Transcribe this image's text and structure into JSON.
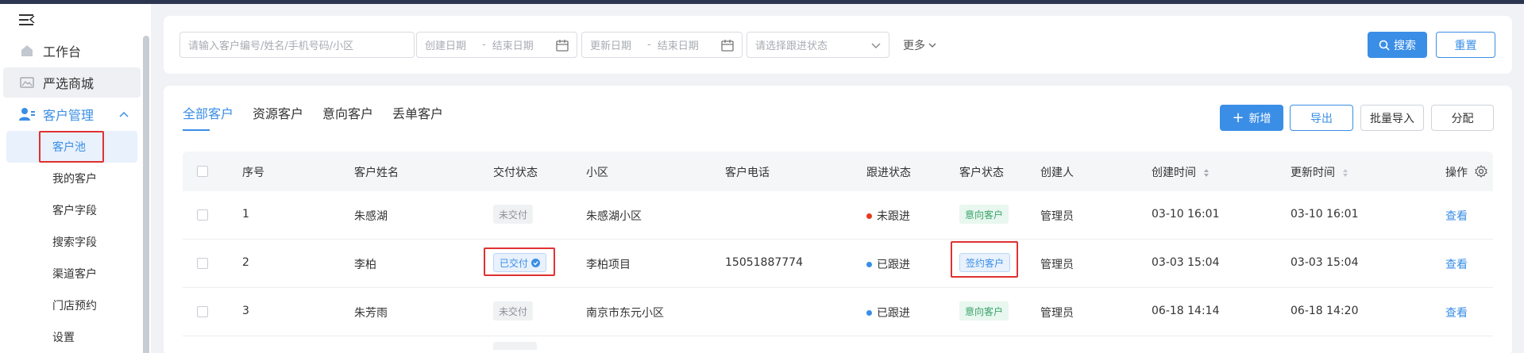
{
  "sidebar": {
    "items": [
      {
        "label": "工作台"
      },
      {
        "label": "严选商城"
      },
      {
        "label": "客户管理"
      }
    ],
    "sub_items": [
      {
        "label": "客户池"
      },
      {
        "label": "我的客户"
      },
      {
        "label": "客户字段"
      },
      {
        "label": "搜索字段"
      },
      {
        "label": "渠道客户"
      },
      {
        "label": "门店预约"
      },
      {
        "label": "设置"
      }
    ]
  },
  "filters": {
    "search_placeholder": "请输入客户编号/姓名/手机号码/小区",
    "created_start": "创建日期",
    "created_end": "结束日期",
    "updated_start": "更新日期",
    "updated_end": "结束日期",
    "follow_status_placeholder": "请选择跟进状态",
    "more_label": "更多",
    "search_button": "搜索",
    "reset_button": "重置",
    "separator": "-"
  },
  "tabs": [
    {
      "label": "全部客户"
    },
    {
      "label": "资源客户"
    },
    {
      "label": "意向客户"
    },
    {
      "label": "丢单客户"
    }
  ],
  "actions": {
    "add": "新增",
    "export": "导出",
    "batch_import": "批量导入",
    "assign": "分配"
  },
  "table": {
    "headers": {
      "index": "序号",
      "name": "客户姓名",
      "delivery": "交付状态",
      "community": "小区",
      "phone": "客户电话",
      "follow": "跟进状态",
      "customer_status": "客户状态",
      "creator": "创建人",
      "created": "创建时间",
      "updated": "更新时间",
      "ops": "操作"
    },
    "rows": [
      {
        "index": "1",
        "name": "朱感湖",
        "delivery": "未交付",
        "community": "朱感湖小区",
        "phone": "",
        "follow": "未跟进",
        "customer_status": "意向客户",
        "creator": "管理员",
        "created": "03-10 16:01",
        "updated": "03-10 16:01",
        "op": "查看"
      },
      {
        "index": "2",
        "name": "李柏",
        "delivery": "已交付",
        "community": "李柏项目",
        "phone": "15051887774",
        "follow": "已跟进",
        "customer_status": "签约客户",
        "creator": "管理员",
        "created": "03-03 15:04",
        "updated": "03-03 15:04",
        "op": "查看"
      },
      {
        "index": "3",
        "name": "朱芳雨",
        "delivery": "未交付",
        "community": "南京市东元小区",
        "phone": "",
        "follow": "已跟进",
        "customer_status": "意向客户",
        "creator": "管理员",
        "created": "06-18 14:14",
        "updated": "06-18 14:20",
        "op": "查看"
      }
    ]
  },
  "colors": {
    "primary": "#3a8ee6",
    "not_followed": "#e8371f",
    "followed": "#3a8ee6",
    "highlight_box": "#e03131"
  }
}
